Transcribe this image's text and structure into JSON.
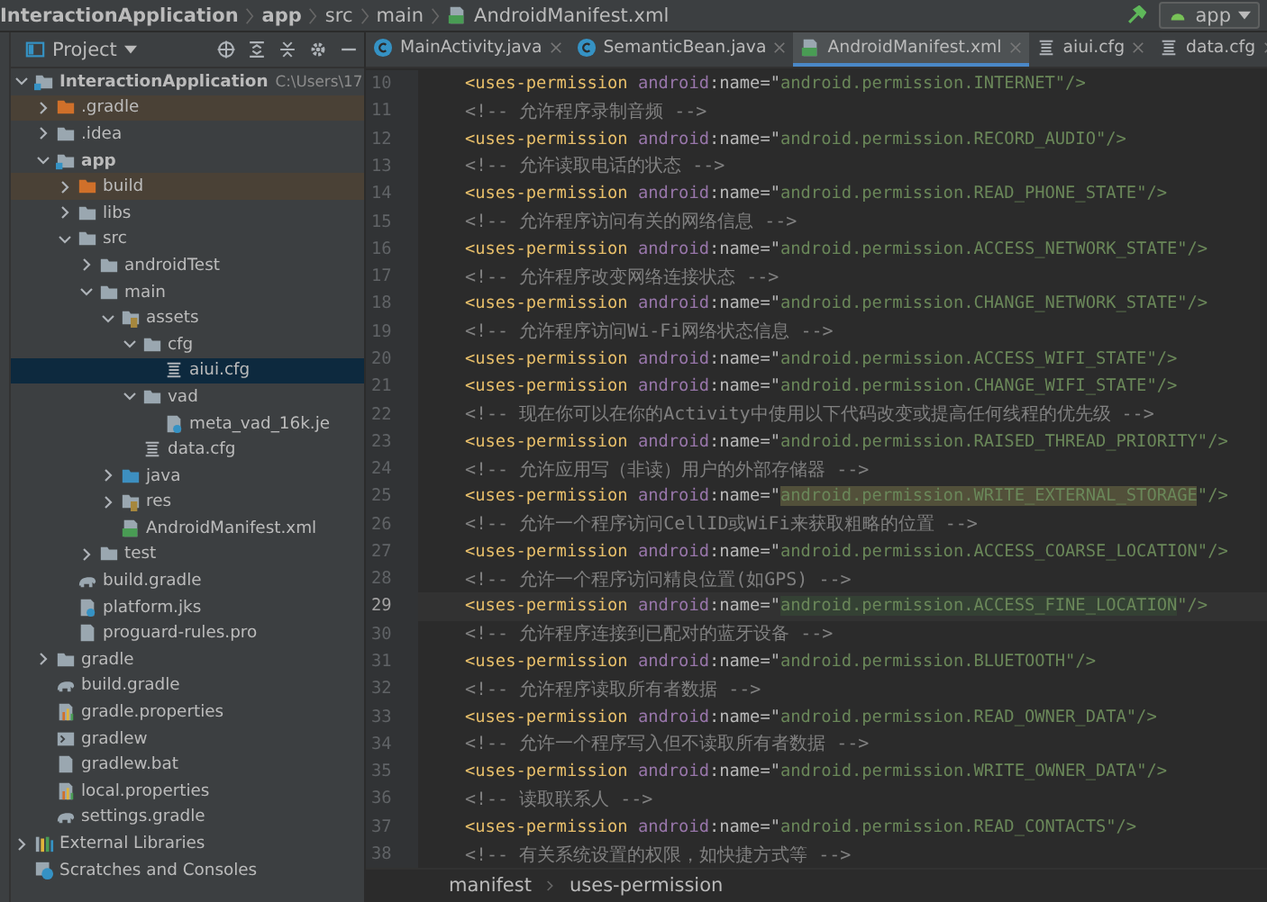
{
  "navbar": {
    "crumbs": [
      "InteractionApplication",
      "app",
      "src",
      "main",
      "AndroidManifest.xml"
    ],
    "run_config": "app"
  },
  "project_panel": {
    "title": "Project"
  },
  "tabs": [
    {
      "label": "MainActivity.java",
      "kind": "class",
      "selected": false
    },
    {
      "label": "SemanticBean.java",
      "kind": "class",
      "selected": false
    },
    {
      "label": "AndroidManifest.xml",
      "kind": "manifest",
      "selected": true
    },
    {
      "label": "aiui.cfg",
      "kind": "text",
      "selected": false
    },
    {
      "label": "data.cfg",
      "kind": "text",
      "selected": false
    }
  ],
  "tree": [
    {
      "label": "InteractionApplication",
      "note": "C:\\Users\\17",
      "kind": "module",
      "expanded": true,
      "selected": false,
      "children": [
        {
          "label": ".gradle",
          "kind": "excluded",
          "expanded": false,
          "selected": false
        },
        {
          "label": ".idea",
          "kind": "folder",
          "expanded": false,
          "selected": false
        },
        {
          "label": "app",
          "kind": "module",
          "expanded": true,
          "selected": false,
          "children": [
            {
              "label": "build",
              "kind": "excluded",
              "expanded": false,
              "selected": false
            },
            {
              "label": "libs",
              "kind": "folder",
              "expanded": false,
              "selected": false
            },
            {
              "label": "src",
              "kind": "folder",
              "expanded": true,
              "selected": false,
              "children": [
                {
                  "label": "androidTest",
                  "kind": "folder",
                  "expanded": false,
                  "selected": false
                },
                {
                  "label": "main",
                  "kind": "folder",
                  "expanded": true,
                  "selected": false,
                  "children": [
                    {
                      "label": "assets",
                      "kind": "resources",
                      "expanded": true,
                      "selected": false,
                      "children": [
                        {
                          "label": "cfg",
                          "kind": "folder",
                          "expanded": true,
                          "selected": false,
                          "children": [
                            {
                              "label": "aiui.cfg",
                              "kind": "text",
                              "selected": true
                            }
                          ]
                        },
                        {
                          "label": "vad",
                          "kind": "folder",
                          "expanded": true,
                          "selected": false,
                          "children": [
                            {
                              "label": "meta_vad_16k.je",
                              "kind": "unknown",
                              "selected": false
                            }
                          ]
                        },
                        {
                          "label": "data.cfg",
                          "kind": "text",
                          "selected": false
                        }
                      ]
                    },
                    {
                      "label": "java",
                      "kind": "sources",
                      "expanded": false,
                      "selected": false
                    },
                    {
                      "label": "res",
                      "kind": "resources",
                      "expanded": false,
                      "selected": false
                    },
                    {
                      "label": "AndroidManifest.xml",
                      "kind": "manifest",
                      "selected": false
                    }
                  ]
                },
                {
                  "label": "test",
                  "kind": "folder",
                  "expanded": false,
                  "selected": false
                }
              ]
            },
            {
              "label": "build.gradle",
              "kind": "gradle",
              "selected": false
            },
            {
              "label": "platform.jks",
              "kind": "unknown",
              "selected": false
            },
            {
              "label": "proguard-rules.pro",
              "kind": "file",
              "selected": false
            }
          ]
        },
        {
          "label": "gradle",
          "kind": "folder",
          "expanded": false,
          "selected": false
        },
        {
          "label": "build.gradle",
          "kind": "gradle",
          "selected": false
        },
        {
          "label": "gradle.properties",
          "kind": "properties",
          "selected": false
        },
        {
          "label": "gradlew",
          "kind": "script",
          "selected": false
        },
        {
          "label": "gradlew.bat",
          "kind": "file",
          "selected": false
        },
        {
          "label": "local.properties",
          "kind": "properties",
          "selected": false
        },
        {
          "label": "settings.gradle",
          "kind": "gradle",
          "selected": false
        }
      ]
    },
    {
      "label": "External Libraries",
      "kind": "library",
      "expanded": false,
      "selected": false
    },
    {
      "label": "Scratches and Consoles",
      "kind": "scratch",
      "selected": false
    }
  ],
  "editor": {
    "lines": [
      {
        "number": "10",
        "kind": "tag",
        "open": "<uses-permission",
        "ns": "android",
        "attr": ":name=\"",
        "value": "android.permission.INTERNET",
        "close": "\"/>",
        "warning": false,
        "current": false
      },
      {
        "number": "11",
        "kind": "comment",
        "text": "<!-- 允许程序录制音频 -->",
        "current": false
      },
      {
        "number": "12",
        "kind": "tag",
        "open": "<uses-permission",
        "ns": "android",
        "attr": ":name=\"",
        "value": "android.permission.RECORD_AUDIO",
        "close": "\"/>",
        "warning": false,
        "current": false
      },
      {
        "number": "13",
        "kind": "comment",
        "text": "<!-- 允许读取电话的状态 -->",
        "current": false
      },
      {
        "number": "14",
        "kind": "tag",
        "open": "<uses-permission",
        "ns": "android",
        "attr": ":name=\"",
        "value": "android.permission.READ_PHONE_STATE",
        "close": "\"/>",
        "warning": false,
        "current": false
      },
      {
        "number": "15",
        "kind": "comment",
        "text": "<!-- 允许程序访问有关的网络信息 -->",
        "current": false
      },
      {
        "number": "16",
        "kind": "tag",
        "open": "<uses-permission",
        "ns": "android",
        "attr": ":name=\"",
        "value": "android.permission.ACCESS_NETWORK_STATE",
        "close": "\"/>",
        "warning": false,
        "current": false
      },
      {
        "number": "17",
        "kind": "comment",
        "text": "<!-- 允许程序改变网络连接状态 -->",
        "current": false
      },
      {
        "number": "18",
        "kind": "tag",
        "open": "<uses-permission",
        "ns": "android",
        "attr": ":name=\"",
        "value": "android.permission.CHANGE_NETWORK_STATE",
        "close": "\"/>",
        "warning": false,
        "current": false
      },
      {
        "number": "19",
        "kind": "comment",
        "text": "<!-- 允许程序访问Wi-Fi网络状态信息 -->",
        "current": false
      },
      {
        "number": "20",
        "kind": "tag",
        "open": "<uses-permission",
        "ns": "android",
        "attr": ":name=\"",
        "value": "android.permission.ACCESS_WIFI_STATE",
        "close": "\"/>",
        "warning": false,
        "current": false
      },
      {
        "number": "21",
        "kind": "tag",
        "open": "<uses-permission",
        "ns": "android",
        "attr": ":name=\"",
        "value": "android.permission.CHANGE_WIFI_STATE",
        "close": "\"/>",
        "warning": false,
        "current": false
      },
      {
        "number": "22",
        "kind": "comment",
        "text": "<!-- 现在你可以在你的Activity中使用以下代码改变或提高任何线程的优先级 -->",
        "current": false
      },
      {
        "number": "23",
        "kind": "tag",
        "open": "<uses-permission",
        "ns": "android",
        "attr": ":name=\"",
        "value": "android.permission.RAISED_THREAD_PRIORITY",
        "close": "\"/>",
        "warning": false,
        "current": false
      },
      {
        "number": "24",
        "kind": "comment",
        "text": "<!-- 允许应用写（非读）用户的外部存储器 -->",
        "current": false
      },
      {
        "number": "25",
        "kind": "tag",
        "open": "<uses-permission",
        "ns": "android",
        "attr": ":name=\"",
        "value": "android.permission.WRITE_EXTERNAL_STORAGE",
        "close": "\"/>",
        "warning": true,
        "current": false
      },
      {
        "number": "26",
        "kind": "comment",
        "text": "<!-- 允许一个程序访问CellID或WiFi来获取粗略的位置 -->",
        "current": false
      },
      {
        "number": "27",
        "kind": "tag",
        "open": "<uses-permission",
        "ns": "android",
        "attr": ":name=\"",
        "value": "android.permission.ACCESS_COARSE_LOCATION",
        "close": "\"/>",
        "warning": false,
        "current": false
      },
      {
        "number": "28",
        "kind": "comment",
        "text": "<!-- 允许一个程序访问精良位置(如GPS) -->",
        "current": false
      },
      {
        "number": "29",
        "kind": "tag",
        "open": "<uses-permission",
        "ns": "android",
        "attr": ":name=\"",
        "value": "android.permission.ACCESS_FINE_LOCATION",
        "close": "\"/>",
        "warning": false,
        "current": true
      },
      {
        "number": "30",
        "kind": "comment",
        "text": "<!-- 允许程序连接到已配对的蓝牙设备 -->",
        "current": false
      },
      {
        "number": "31",
        "kind": "tag",
        "open": "<uses-permission",
        "ns": "android",
        "attr": ":name=\"",
        "value": "android.permission.BLUETOOTH",
        "close": "\"/>",
        "warning": false,
        "current": false
      },
      {
        "number": "32",
        "kind": "comment",
        "text": "<!-- 允许程序读取所有者数据 -->",
        "current": false
      },
      {
        "number": "33",
        "kind": "tag",
        "open": "<uses-permission",
        "ns": "android",
        "attr": ":name=\"",
        "value": "android.permission.READ_OWNER_DATA",
        "close": "\"/>",
        "warning": false,
        "current": false
      },
      {
        "number": "34",
        "kind": "comment",
        "text": "<!-- 允许一个程序写入但不读取所有者数据 -->",
        "current": false
      },
      {
        "number": "35",
        "kind": "tag",
        "open": "<uses-permission",
        "ns": "android",
        "attr": ":name=\"",
        "value": "android.permission.WRITE_OWNER_DATA",
        "close": "\"/>",
        "warning": false,
        "current": false
      },
      {
        "number": "36",
        "kind": "comment",
        "text": "<!-- 读取联系人 -->",
        "current": false
      },
      {
        "number": "37",
        "kind": "tag",
        "open": "<uses-permission",
        "ns": "android",
        "attr": ":name=\"",
        "value": "android.permission.READ_CONTACTS",
        "close": "\"/>",
        "warning": false,
        "current": false
      },
      {
        "number": "38",
        "kind": "comment",
        "text": "<!-- 有关系统设置的权限，如快捷方式等 -->",
        "current": false
      }
    ]
  },
  "status_breadcrumb": [
    "manifest",
    "uses-permission"
  ]
}
